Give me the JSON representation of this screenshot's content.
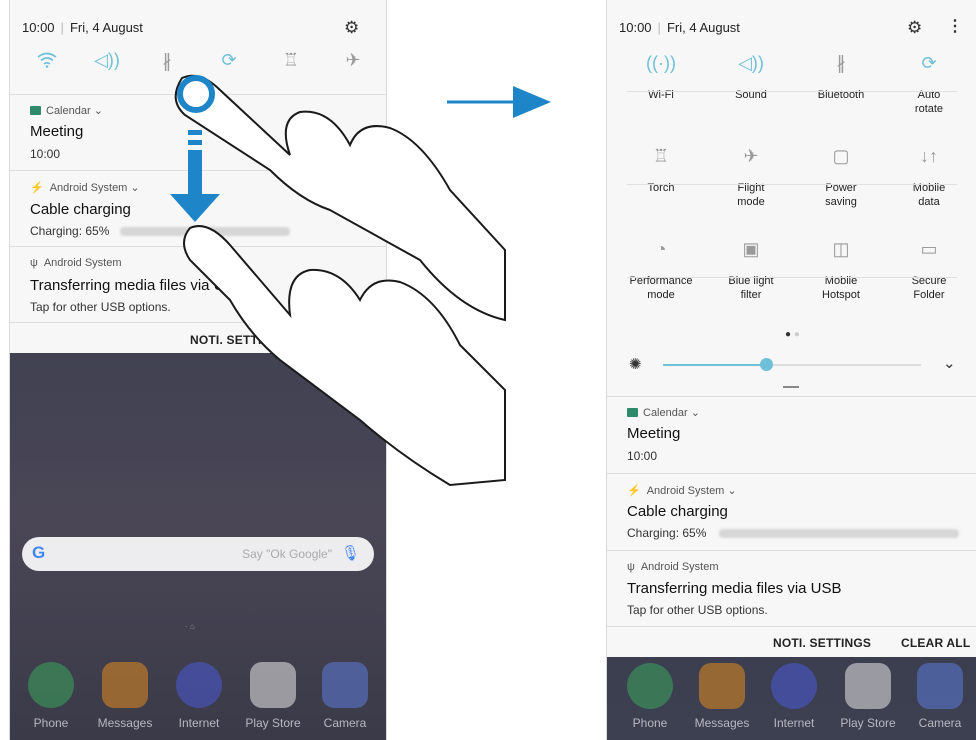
{
  "left_phone": {
    "status": {
      "time": "10:00",
      "separator": "|",
      "date": "Fri, 4 August"
    },
    "quick_icons": [
      "wifi-icon",
      "sound-icon",
      "bluetooth-icon",
      "auto-rotate-icon",
      "torch-icon",
      "flight-mode-icon"
    ],
    "notifications": [
      {
        "app": "Calendar ⌄",
        "title": "Meeting",
        "sub": "10:00"
      },
      {
        "app": "Android System ⌄",
        "title": "Cable charging",
        "sub": "Charging: 65%"
      },
      {
        "app": "Android System",
        "title": "Transferring media files via U",
        "sub": "Tap for other USB options."
      }
    ],
    "action": "NOTI. SETTINGS",
    "search_hint": "Say \"Ok Google\"",
    "google_letter": "G",
    "dock": [
      "Phone",
      "Messages",
      "Internet",
      "Play Store",
      "Camera"
    ]
  },
  "arrow_symbol": "⟶",
  "right_phone": {
    "status": {
      "time": "10:00",
      "separator": "|",
      "date": "Fri, 4 August"
    },
    "tiles": [
      {
        "label": "Wi-Fi",
        "icon": "wifi-icon",
        "on": true
      },
      {
        "label": "Sound",
        "icon": "sound-icon",
        "on": true
      },
      {
        "label": "Bluetooth",
        "icon": "bluetooth-icon",
        "on": false
      },
      {
        "label": "Auto\nrotate",
        "icon": "auto-rotate-icon",
        "on": true
      },
      {
        "label": "Torch",
        "icon": "torch-icon",
        "on": false
      },
      {
        "label": "Flight\nmode",
        "icon": "flight-mode-icon",
        "on": false
      },
      {
        "label": "Power\nsaving",
        "icon": "power-saving-icon",
        "on": false
      },
      {
        "label": "Mobile\ndata",
        "icon": "mobile-data-icon",
        "on": false
      },
      {
        "label": "Performance\nmode",
        "icon": "performance-mode-icon",
        "on": false
      },
      {
        "label": "Blue light\nfilter",
        "icon": "blue-light-filter-icon",
        "on": false
      },
      {
        "label": "Mobile\nHotspot",
        "icon": "mobile-hotspot-icon",
        "on": false
      },
      {
        "label": "Secure\nFolder",
        "icon": "secure-folder-icon",
        "on": false
      }
    ],
    "brightness": 0.4,
    "notifications": [
      {
        "app": "Calendar ⌄",
        "title": "Meeting",
        "sub": "10:00"
      },
      {
        "app": "Android System ⌄",
        "title": "Cable charging",
        "sub": "Charging: 65%"
      },
      {
        "app": "Android System",
        "title": "Transferring media files via USB",
        "sub": "Tap for other USB options."
      }
    ],
    "actions": {
      "settings": "NOTI. SETTINGS",
      "clear": "CLEAR ALL"
    },
    "dock": [
      "Phone",
      "Messages",
      "Internet",
      "Play Store",
      "Camera"
    ]
  },
  "colors": {
    "accent": "#6fbfd9",
    "arrow": "#1e86c8",
    "tile_off": "#9a9a9a"
  }
}
